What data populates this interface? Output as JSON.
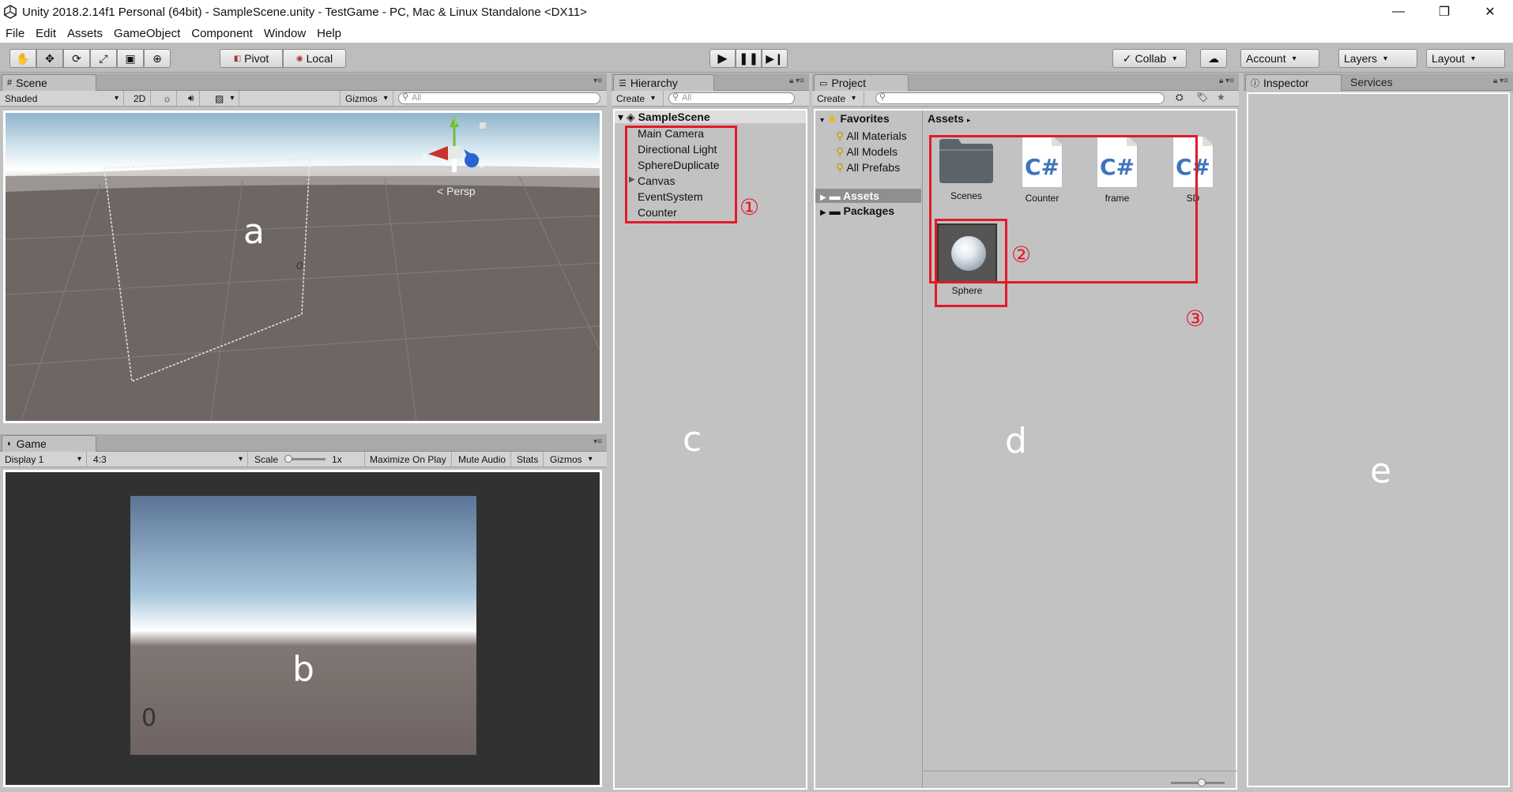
{
  "window": {
    "title": "Unity 2018.2.14f1 Personal (64bit) - SampleScene.unity - TestGame - PC, Mac & Linux Standalone <DX11>",
    "minimize": "—",
    "maximize": "❐",
    "close": "✕"
  },
  "menu": [
    "File",
    "Edit",
    "Assets",
    "GameObject",
    "Component",
    "Window",
    "Help"
  ],
  "toolbar": {
    "pivot": "Pivot",
    "local": "Local",
    "collab": "Collab",
    "account": "Account",
    "layers": "Layers",
    "layout": "Layout"
  },
  "scene": {
    "tab": "Scene",
    "shading": "Shaded",
    "mode2d": "2D",
    "gizmos": "Gizmos",
    "search_placeholder": "All",
    "persp": "Persp",
    "gizmo_y": "y",
    "gizmo_x": "x",
    "gizmo_z": "z",
    "zero": "0",
    "label": "a"
  },
  "game": {
    "tab": "Game",
    "display": "Display 1",
    "aspect": "4:3",
    "scale_label": "Scale",
    "scale_value": "1x",
    "maximize": "Maximize On Play",
    "mute": "Mute Audio",
    "stats": "Stats",
    "gizmos": "Gizmos",
    "zero": "0",
    "label": "b"
  },
  "hierarchy": {
    "tab": "Hierarchy",
    "create": "Create",
    "search_placeholder": "All",
    "scene_name": "SampleScene",
    "items": [
      "Main Camera",
      "Directional Light",
      "SphereDuplicate",
      "Canvas",
      "EventSystem",
      "Counter"
    ],
    "marker": "①",
    "label": "c"
  },
  "project": {
    "tab": "Project",
    "create": "Create",
    "favorites": "Favorites",
    "fav_items": [
      "All Materials",
      "All Models",
      "All Prefabs"
    ],
    "assets_root": "Assets",
    "packages": "Packages",
    "breadcrumb": "Assets",
    "assets": [
      {
        "name": "Scenes",
        "kind": "folder"
      },
      {
        "name": "Counter",
        "kind": "script"
      },
      {
        "name": "frame",
        "kind": "script"
      },
      {
        "name": "SD",
        "kind": "script"
      }
    ],
    "script_glyph": "C#",
    "prefab": "Sphere",
    "marker2": "②",
    "marker3": "③",
    "label": "d"
  },
  "inspector": {
    "tab": "Inspector",
    "services": "Services",
    "label": "e"
  },
  "colors": {
    "annotation": "#e21a27",
    "panel_bg": "#c2c2c2"
  }
}
